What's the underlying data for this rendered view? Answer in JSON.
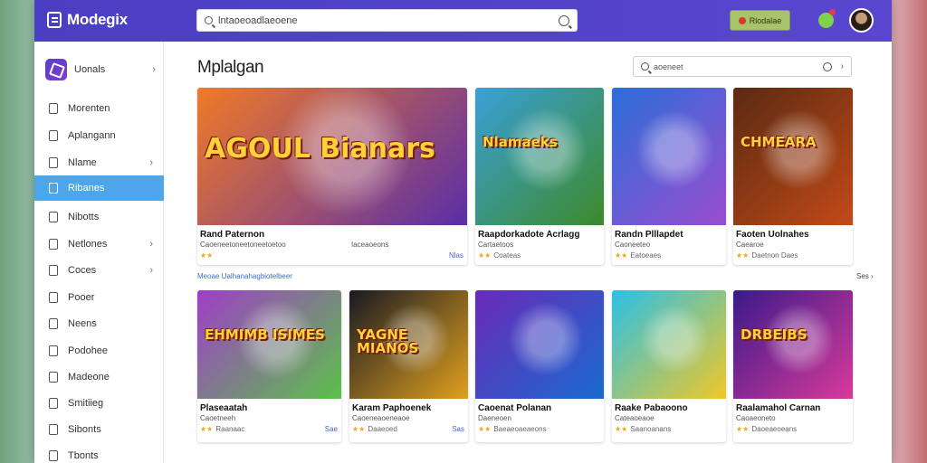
{
  "app": {
    "logo": "Modegix"
  },
  "topbar": {
    "search_text": "lntaoeoadlaeoene",
    "cta_label": "Rlodalae"
  },
  "sidebar": {
    "header": "Uonals",
    "items": [
      {
        "label": "Morenten",
        "chevron": false,
        "active": false
      },
      {
        "label": "Aplangann",
        "chevron": false,
        "active": false
      },
      {
        "label": "Nlame",
        "chevron": true,
        "active": false
      },
      {
        "label": "Ribanes",
        "chevron": false,
        "active": true
      },
      {
        "label": "Nibotts",
        "chevron": false,
        "active": false
      },
      {
        "label": "Netlones",
        "chevron": true,
        "active": false
      },
      {
        "label": "Coces",
        "chevron": true,
        "active": false
      },
      {
        "label": "Pooer",
        "chevron": false,
        "active": false
      },
      {
        "label": "Neens",
        "chevron": false,
        "active": false
      },
      {
        "label": "Podohee",
        "chevron": false,
        "active": false
      },
      {
        "label": "Madeone",
        "chevron": false,
        "active": false
      },
      {
        "label": "Smitiieg",
        "chevron": false,
        "active": false
      },
      {
        "label": "Sibonts",
        "chevron": false,
        "active": false
      },
      {
        "label": "Tbonts",
        "chevron": false,
        "active": false
      }
    ]
  },
  "main": {
    "title": "Mplalgan",
    "filter_text": "aoeneet",
    "section_label": "Meoae Ualhanahagbiotelbeer",
    "see_all": "Ses",
    "row1": [
      {
        "thumb_text": "AGOUL Bianars",
        "name": "Rand Paternon",
        "sub": "Caoeneetoneetoneetoetoo",
        "sub2": "Iaceaoeons",
        "meta": "",
        "price": "Nlas",
        "colors": [
          "#f07a28",
          "#5a2ea8"
        ]
      },
      {
        "thumb_text": "Nlamaeks",
        "name": "Raapdorkadote Acrlagg",
        "sub": "Cartaetoos",
        "meta": "Coateas",
        "price": "",
        "colors": [
          "#3aa0d8",
          "#3c8a2a"
        ]
      },
      {
        "thumb_text": "",
        "name": "Randn Plllapdet",
        "sub": "Caoneeteo",
        "meta": "Eatoeaes",
        "price": "",
        "colors": [
          "#2b6ed8",
          "#9a4dd0"
        ]
      },
      {
        "thumb_text": "CHMEARA",
        "name": "Faoten Uolnahes",
        "sub": "Caearoe",
        "meta": "Daetnon Daes",
        "price": "",
        "colors": [
          "#5a2a12",
          "#c24a18"
        ]
      }
    ],
    "row2": [
      {
        "thumb_text": "EHMIMB ISIMES",
        "name": "Plaseaatah",
        "sub": "Caoetneeh",
        "meta": "Raanaac",
        "price": "Sae",
        "colors": [
          "#a03ec8",
          "#5cc04a"
        ]
      },
      {
        "thumb_text": "YAGNE MIANOS",
        "name": "Karam Paphoenek",
        "sub": "Caoeneaoeneaoe",
        "meta": "Daaeoed",
        "price": "Sas",
        "colors": [
          "#1a1a22",
          "#e0a020"
        ]
      },
      {
        "thumb_text": "",
        "name": "Caoenat Polanan",
        "sub": "Daeneoen",
        "meta": "Baeaeoaeaeons",
        "price": "",
        "colors": [
          "#6a2ab8",
          "#1a6ad0"
        ]
      },
      {
        "thumb_text": "",
        "name": "Raake Pabaoono",
        "sub": "Cateaoeaoe",
        "meta": "Saanoanans",
        "price": "",
        "colors": [
          "#2ac0e8",
          "#f0c828"
        ]
      },
      {
        "thumb_text": "DRBEIBS",
        "name": "Raalamahol Carnan",
        "sub": "Caoaeoneto",
        "meta": "Daoeaeoeans",
        "price": "",
        "colors": [
          "#3a1a8a",
          "#d83a9a"
        ]
      }
    ]
  }
}
